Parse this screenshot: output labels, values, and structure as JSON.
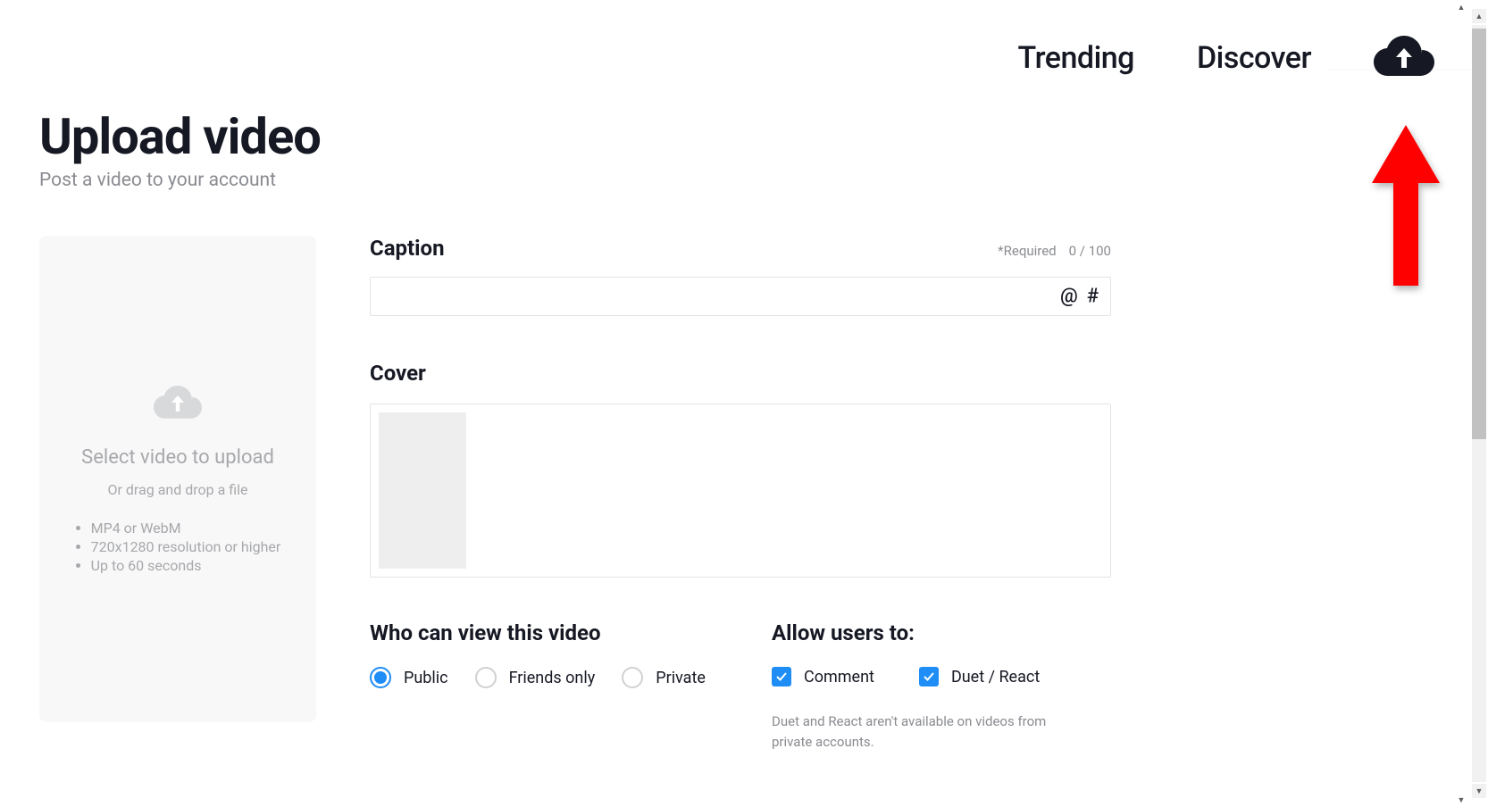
{
  "nav": {
    "trending": "Trending",
    "discover": "Discover"
  },
  "page": {
    "title": "Upload video",
    "subtitle": "Post a video to your account"
  },
  "upload_box": {
    "title": "Select video to upload",
    "drag": "Or drag and drop a file",
    "reqs": [
      "MP4 or WebM",
      "720x1280 resolution or higher",
      "Up to 60 seconds"
    ]
  },
  "caption": {
    "label": "Caption",
    "required": "*Required",
    "counter": "0 / 100",
    "at": "@",
    "hash": "#"
  },
  "cover": {
    "label": "Cover"
  },
  "visibility": {
    "heading": "Who can view this video",
    "options": [
      {
        "label": "Public",
        "selected": true
      },
      {
        "label": "Friends only",
        "selected": false
      },
      {
        "label": "Private",
        "selected": false
      }
    ]
  },
  "allow": {
    "heading": "Allow users to:",
    "options": [
      {
        "label": "Comment",
        "checked": true
      },
      {
        "label": "Duet / React",
        "checked": true
      }
    ],
    "note": "Duet and React aren't available on videos from private accounts."
  }
}
